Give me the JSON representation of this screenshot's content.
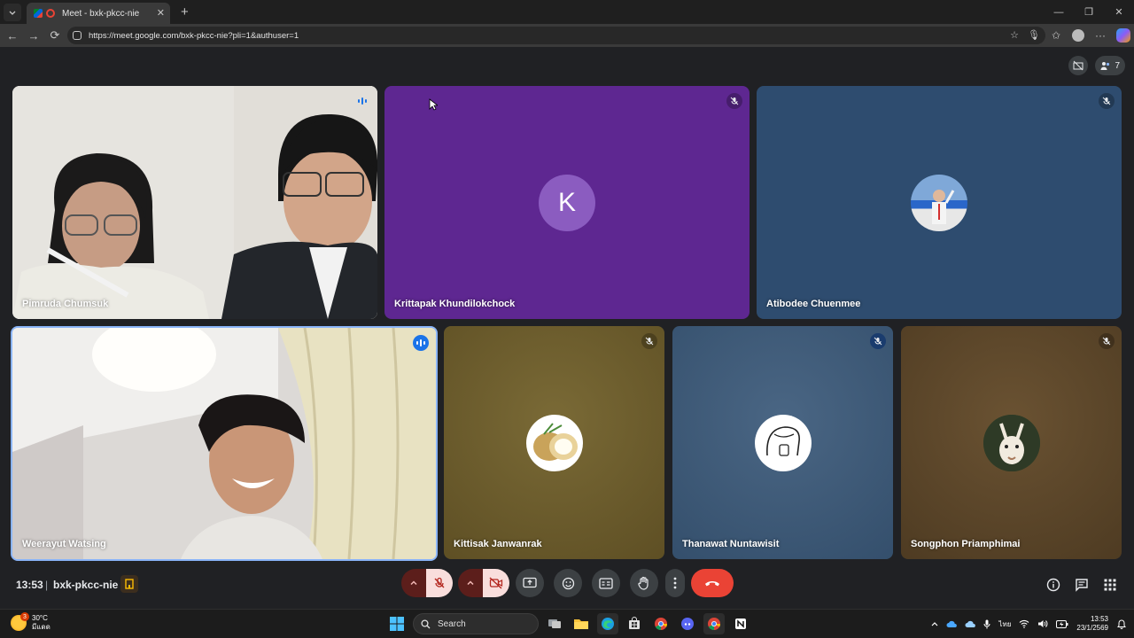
{
  "browser": {
    "tab_title": "Meet - bxk-pkcc-nie",
    "url": "https://meet.google.com/bxk-pkcc-nie?pli=1&authuser=1"
  },
  "meet": {
    "participant_count": "7",
    "tiles": [
      {
        "name": "Pimruda Chumsuk",
        "mic": "speaking",
        "type": "video"
      },
      {
        "name": "Krittapak Khundilokchock",
        "mic": "muted",
        "type": "avatar",
        "initial": "K",
        "bg": "#6a2a98",
        "avatar_color": "#8e5bc2"
      },
      {
        "name": "Atibodee Chuenmee",
        "mic": "muted",
        "type": "avatar",
        "bg": "#2f4e72"
      },
      {
        "name": "Weerayut Watsing",
        "mic": "speaking",
        "type": "video"
      },
      {
        "name": "Kittisak Janwanrak",
        "mic": "muted",
        "type": "avatar",
        "bg": "#6a5a2a"
      },
      {
        "name": "Thanawat Nuntawisit",
        "mic": "muted",
        "type": "avatar",
        "bg": "#3c5777"
      },
      {
        "name": "Songphon Priamphimai",
        "mic": "muted",
        "type": "avatar",
        "bg": "#5a4428"
      }
    ],
    "clock": "13:53",
    "separator": "|",
    "meeting_code": "bxk-pkcc-nie"
  },
  "taskbar": {
    "weather_temp": "30°C",
    "weather_desc": "มีแดด",
    "weather_badge": "3",
    "search_placeholder": "Search",
    "language": "ไทย",
    "time": "13:53",
    "date": "23/1/2569"
  },
  "colors": {
    "meet_bg": "#202124",
    "end_call": "#ea4335",
    "speaking": "#1a73e8"
  }
}
